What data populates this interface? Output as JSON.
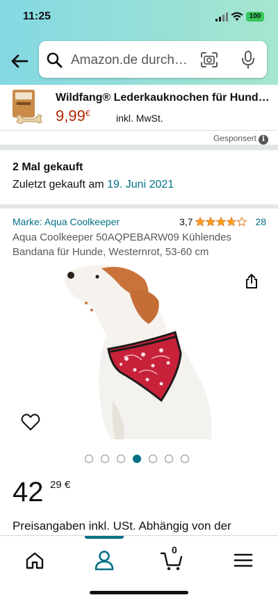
{
  "status_bar": {
    "time": "11:25",
    "battery": "100"
  },
  "search": {
    "placeholder": "Amazon.de durchsuchen"
  },
  "ad": {
    "title": "Wildfang® Lederkauknochen für Hunde...",
    "price": "9,99",
    "currency": "€",
    "tax": "inkl. MwSt.",
    "sponsored_label": "Gesponsert"
  },
  "purchase_history": {
    "title": "2 Mal gekauft",
    "last_bought_prefix": "Zuletzt gekauft am",
    "last_bought_date": "19. Juni 2021"
  },
  "product": {
    "brand": "Marke: Aqua Coolkeeper",
    "rating": "3,7",
    "rating_value": 3.7,
    "rating_count": "28",
    "title": "Aqua Coolkeeper 50AQPEBARW09 Kühlendes Bandana für Hunde, Westernrot, 53-60 cm",
    "image_count": 7,
    "active_image_index": 3,
    "price_whole": "42",
    "price_fraction": "29 €",
    "price_note": "Preisangaben inkl. USt. Abhängig von der"
  },
  "bottom_nav": {
    "items": [
      {
        "name": "home-icon"
      },
      {
        "name": "account-icon",
        "active": true
      },
      {
        "name": "cart-icon",
        "count": "0"
      },
      {
        "name": "menu-icon"
      }
    ]
  },
  "colors": {
    "accent": "#007185",
    "price_red": "#b12704",
    "star": "#ffa41c",
    "header_left": "#84d8e3",
    "header_right": "#a6e6ce"
  }
}
